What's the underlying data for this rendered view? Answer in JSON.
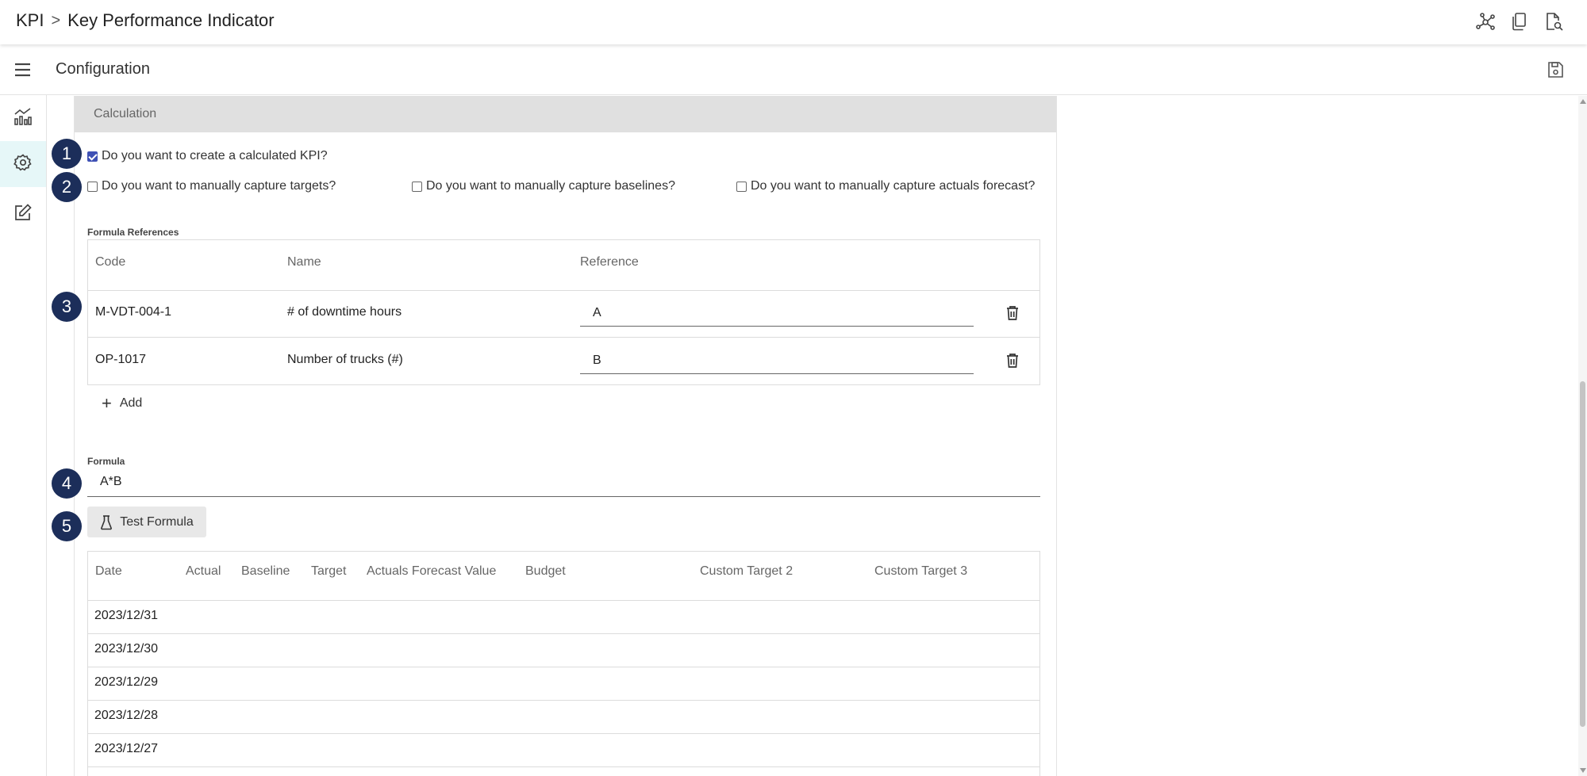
{
  "breadcrumb": {
    "root": "KPI",
    "separator": ">",
    "current": "Key Performance Indicator"
  },
  "topbar": {
    "icons": [
      "network-icon",
      "copy-icon",
      "document-search-icon"
    ]
  },
  "subheader": {
    "title": "Configuration"
  },
  "sidebar": {
    "items": [
      {
        "icon": "chart-icon",
        "active": false
      },
      {
        "icon": "gear-icon",
        "active": true
      },
      {
        "icon": "edit-icon",
        "active": false
      }
    ]
  },
  "section": {
    "title": "Calculation"
  },
  "checkboxes": {
    "calculated_kpi": {
      "label": "Do you want to create a calculated KPI?",
      "checked": true
    },
    "manual_targets": {
      "label": "Do you want to manually capture targets?",
      "checked": false
    },
    "manual_baselines": {
      "label": "Do you want to manually capture baselines?",
      "checked": false
    },
    "manual_forecast": {
      "label": "Do you want to manually capture actuals forecast?",
      "checked": false
    }
  },
  "formula_references": {
    "label": "Formula References",
    "headers": [
      "Code",
      "Name",
      "Reference"
    ],
    "rows": [
      {
        "code": "M-VDT-004-1",
        "name": "# of downtime hours",
        "reference": "A"
      },
      {
        "code": "OP-1017",
        "name": "Number of trucks (#)",
        "reference": "B"
      }
    ],
    "add_label": "Add"
  },
  "formula": {
    "label": "Formula",
    "value": "A*B"
  },
  "test_button": {
    "label": "Test Formula"
  },
  "results": {
    "headers": [
      "Date",
      "Actual",
      "Baseline",
      "Target",
      "Actuals Forecast Value",
      "Budget",
      "Custom Target 2",
      "Custom Target 3"
    ],
    "rows": [
      "2023/12/31",
      "2023/12/30",
      "2023/12/29",
      "2023/12/28",
      "2023/12/27"
    ]
  },
  "markers": [
    "1",
    "2",
    "3",
    "4",
    "5"
  ],
  "colors": {
    "marker": "#1c2e5a",
    "accent": "#3f51b5",
    "section_header": "#e0e0e0",
    "active_nav": "#e6f7f8"
  }
}
